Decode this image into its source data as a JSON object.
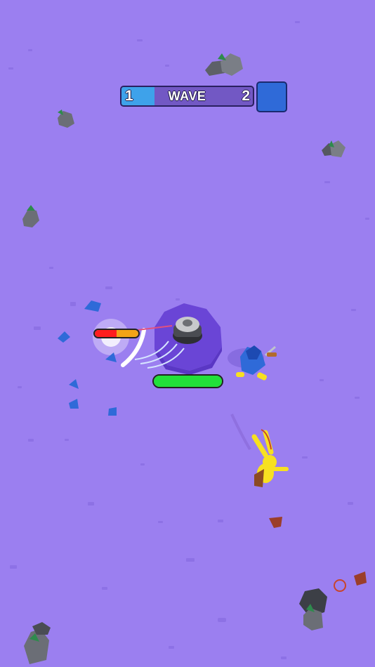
{
  "hud": {
    "wave_label": "WAVE",
    "wave_start": "1",
    "wave_end": "2",
    "wave_progress": 0.25,
    "boss_icon": "blue-armored-knight-icon"
  },
  "player": {
    "health_fraction": 1.0,
    "health_color": "#22e03a"
  },
  "enemy": {
    "health_fraction": 0.5,
    "health_colors": [
      "#ff1e1e",
      "#f2a317"
    ]
  },
  "colors": {
    "ground": "#9b7ff0",
    "arena": "#6a45d6",
    "rock": "#666a72",
    "moss": "#2e8a4d",
    "hero": "#f7e021",
    "knight": "#2f6ad8"
  }
}
